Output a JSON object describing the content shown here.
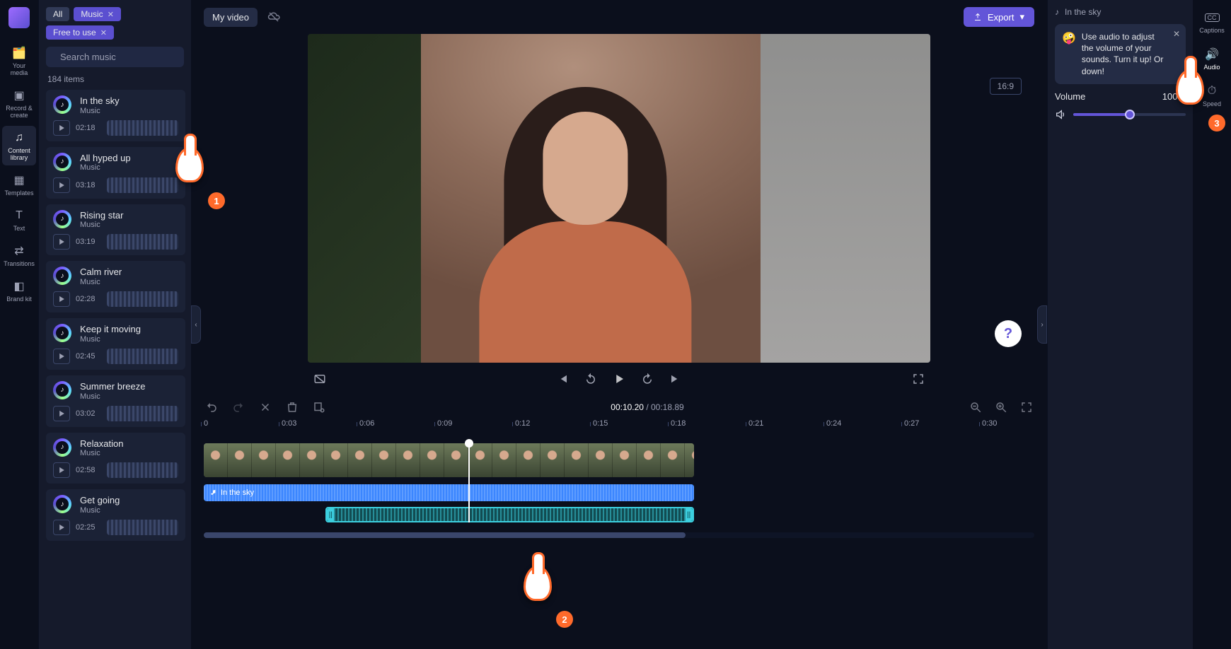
{
  "nav": {
    "items": [
      {
        "id": "your-media",
        "label": "Your media"
      },
      {
        "id": "record",
        "label": "Record & create"
      },
      {
        "id": "content-library",
        "label": "Content library"
      },
      {
        "id": "templates",
        "label": "Templates"
      },
      {
        "id": "text",
        "label": "Text"
      },
      {
        "id": "transitions",
        "label": "Transitions"
      },
      {
        "id": "brand-kit",
        "label": "Brand kit"
      }
    ]
  },
  "media": {
    "chips": {
      "all": "All",
      "music": "Music",
      "free": "Free to use"
    },
    "search_placeholder": "Search music",
    "count_label": "184 items",
    "items": [
      {
        "title": "In the sky",
        "subtitle": "Music",
        "duration": "02:18"
      },
      {
        "title": "All hyped up",
        "subtitle": "Music",
        "duration": "03:18"
      },
      {
        "title": "Rising star",
        "subtitle": "Music",
        "duration": "03:19"
      },
      {
        "title": "Calm river",
        "subtitle": "Music",
        "duration": "02:28"
      },
      {
        "title": "Keep it moving",
        "subtitle": "Music",
        "duration": "02:45"
      },
      {
        "title": "Summer breeze",
        "subtitle": "Music",
        "duration": "03:02"
      },
      {
        "title": "Relaxation",
        "subtitle": "Music",
        "duration": "02:58"
      },
      {
        "title": "Get going",
        "subtitle": "Music",
        "duration": "02:25"
      }
    ]
  },
  "topbar": {
    "title": "My video",
    "export": "Export"
  },
  "preview": {
    "aspect_label": "16:9"
  },
  "playhead": {
    "current": "00:10.20",
    "total": "00:18.89",
    "sep": " / "
  },
  "ruler": [
    "0",
    "0:03",
    "0:06",
    "0:09",
    "0:12",
    "0:15",
    "0:18",
    "0:21",
    "0:24",
    "0:27",
    "0:30"
  ],
  "audio_clip": {
    "label": "In the sky"
  },
  "props": {
    "selected": "In the sky",
    "tip": "Use audio to adjust the volume of your sounds. Turn it up! Or down!",
    "volume_label": "Volume",
    "volume_value_text": "100%",
    "volume_percent": 50
  },
  "tool_rail": {
    "items": [
      {
        "id": "captions",
        "label": "Captions"
      },
      {
        "id": "audio",
        "label": "Audio"
      },
      {
        "id": "speed",
        "label": "Speed"
      }
    ]
  },
  "callouts": {
    "one": "1",
    "two": "2",
    "three": "3"
  }
}
